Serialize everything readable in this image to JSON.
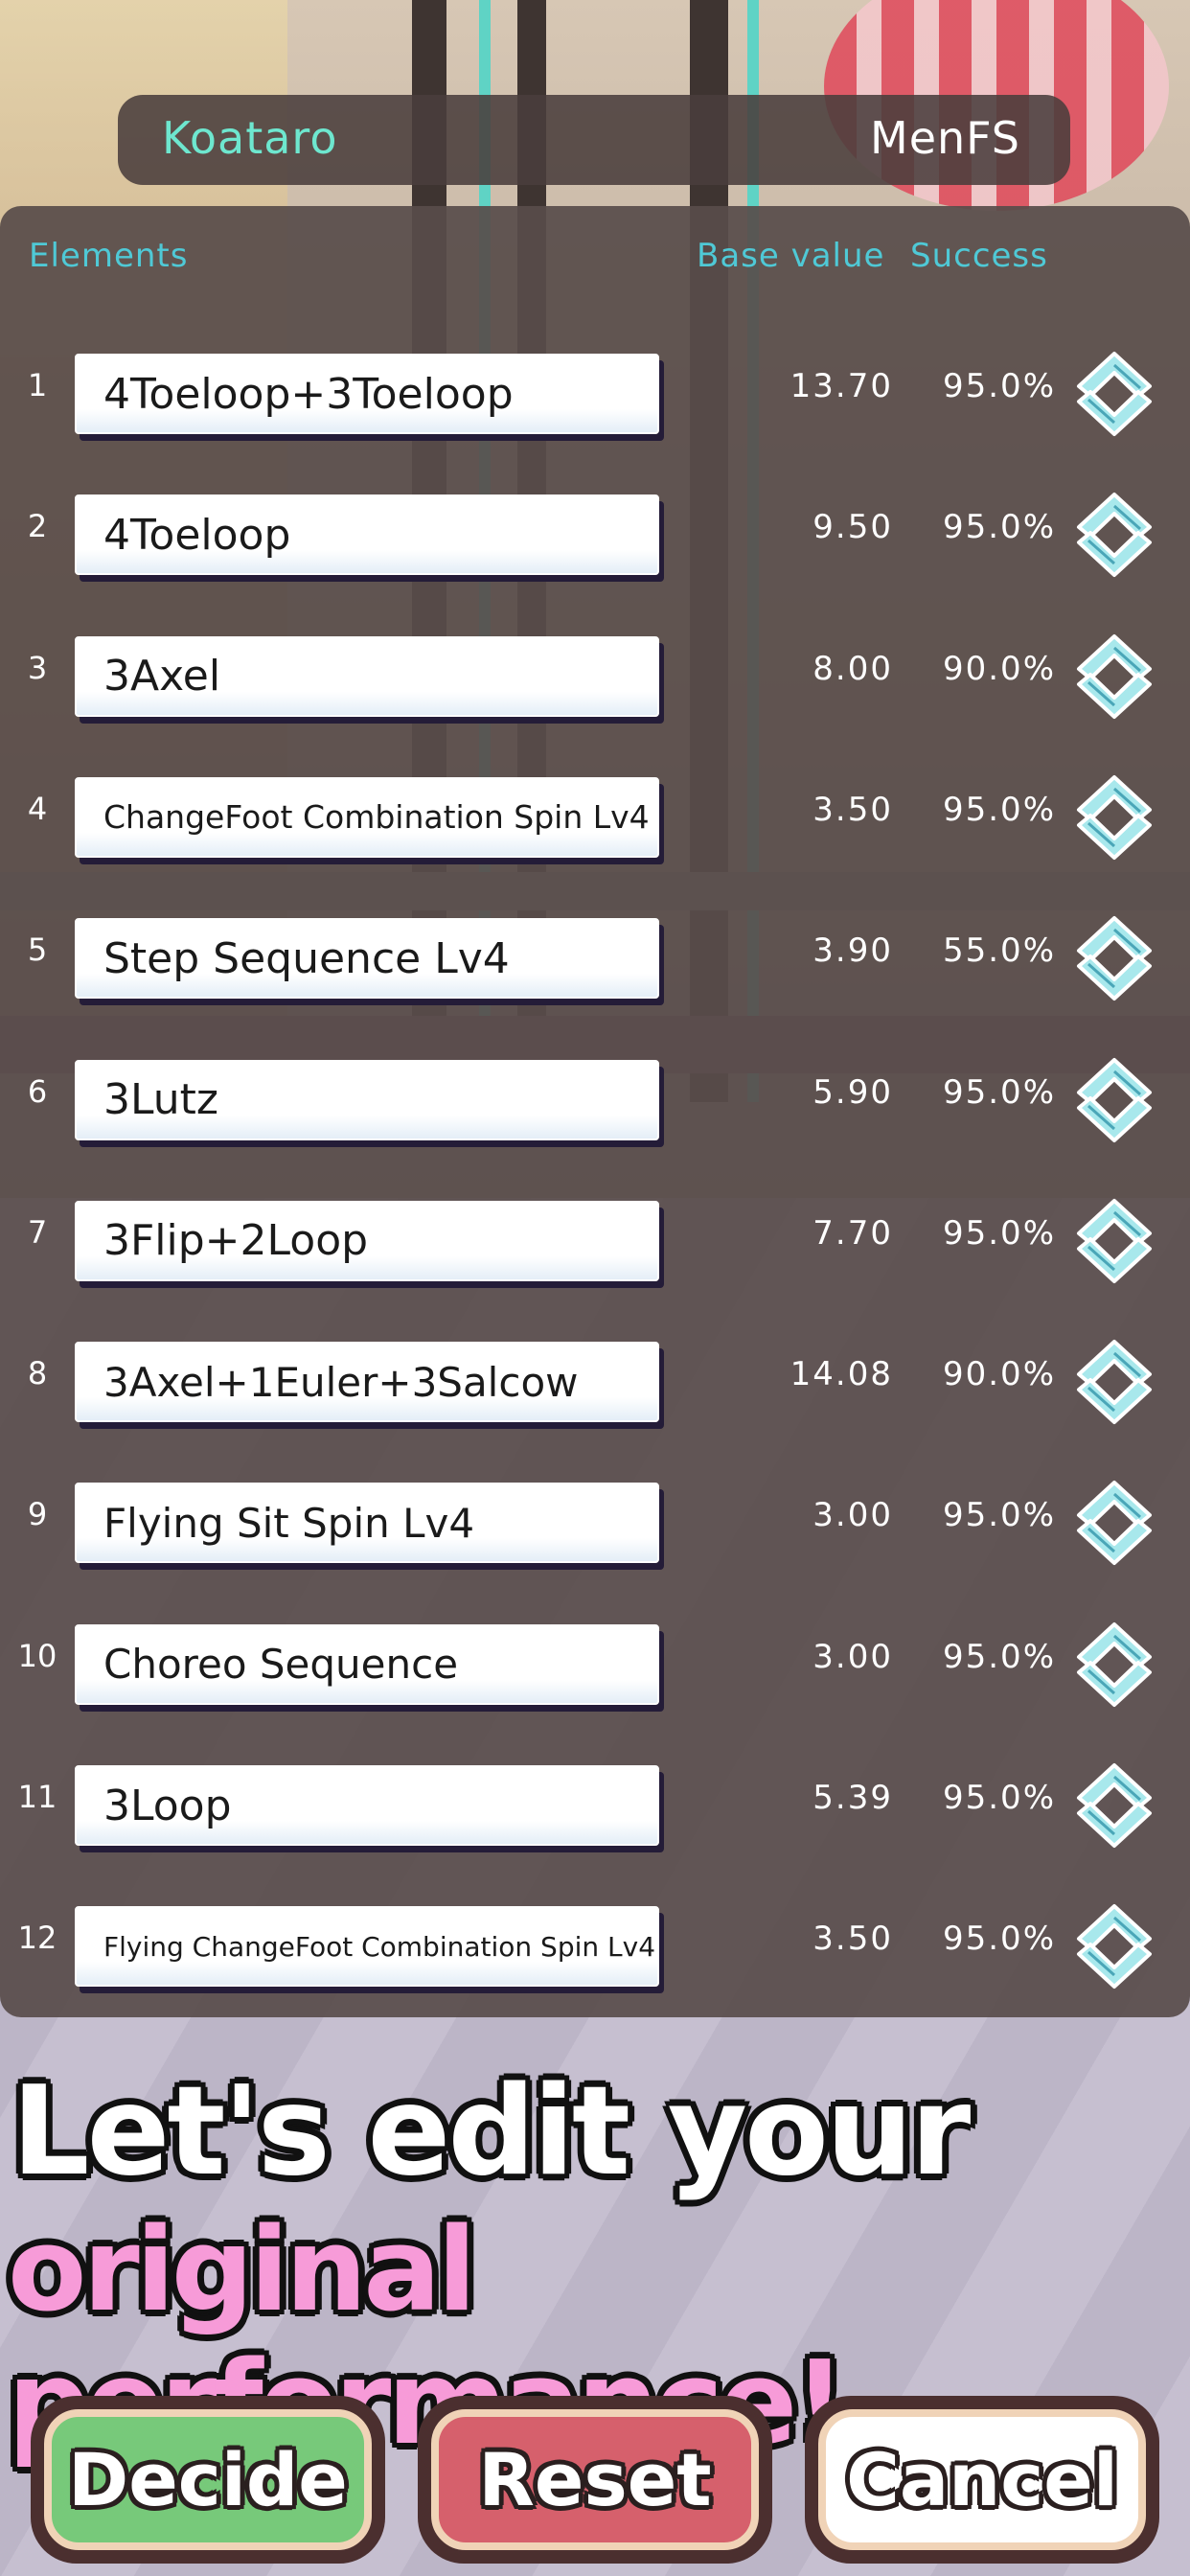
{
  "header": {
    "name": "Koataro",
    "event": "MenFS"
  },
  "columns": {
    "elements": "Elements",
    "base_value": "Base value",
    "success": "Success"
  },
  "rows": [
    {
      "num": "1",
      "element": "4Toeloop+3Toeloop",
      "base": "13.70",
      "success": "95.0%",
      "font_size": 44
    },
    {
      "num": "2",
      "element": "4Toeloop",
      "base": "9.50",
      "success": "95.0%",
      "font_size": 44
    },
    {
      "num": "3",
      "element": "3Axel",
      "base": "8.00",
      "success": "90.0%",
      "font_size": 44
    },
    {
      "num": "4",
      "element": "ChangeFoot Combination Spin Lv4",
      "base": "3.50",
      "success": "95.0%",
      "font_size": 33
    },
    {
      "num": "5",
      "element": "Step Sequence Lv4",
      "base": "3.90",
      "success": "55.0%",
      "font_size": 44
    },
    {
      "num": "6",
      "element": "3Lutz",
      "base": "5.90",
      "success": "95.0%",
      "font_size": 44
    },
    {
      "num": "7",
      "element": "3Flip+2Loop",
      "base": "7.70",
      "success": "95.0%",
      "font_size": 44
    },
    {
      "num": "8",
      "element": "3Axel+1Euler+3Salcow",
      "base": "14.08",
      "success": "90.0%",
      "font_size": 42
    },
    {
      "num": "9",
      "element": "Flying Sit Spin Lv4",
      "base": "3.00",
      "success": "95.0%",
      "font_size": 42
    },
    {
      "num": "10",
      "element": "Choreo Sequence",
      "base": "3.00",
      "success": "95.0%",
      "font_size": 42
    },
    {
      "num": "11",
      "element": "3Loop",
      "base": "5.39",
      "success": "95.0%",
      "font_size": 44
    },
    {
      "num": "12",
      "element": "Flying ChangeFoot Combination Spin Lv4",
      "base": "3.50",
      "success": "95.0%",
      "font_size": 28
    }
  ],
  "promo": {
    "line1": "Let's edit your",
    "line2": "original performance!"
  },
  "buttons": {
    "decide": "Decide",
    "reset": "Reset",
    "cancel": "Cancel"
  },
  "icons": {
    "reorder": "reorder-updown-icon"
  },
  "colors": {
    "name_text": "#6ee7cf",
    "column_header_text": "#4fc9d6",
    "panel": "#584c4a",
    "promo_line2": "#f79bd8",
    "decide": "#77c97a",
    "reset": "#d6606c",
    "cancel": "#ffffff"
  }
}
